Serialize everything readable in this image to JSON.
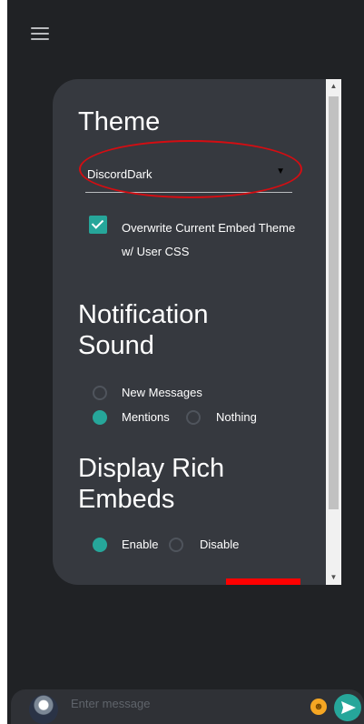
{
  "settings": {
    "theme": {
      "heading": "Theme",
      "selected": "DiscordDark",
      "overwrite_label": "Overwrite Current Embed Theme w/ User CSS",
      "overwrite_checked": true
    },
    "notification": {
      "heading": "Notification Sound",
      "options": [
        "New Messages",
        "Mentions",
        "Nothing"
      ],
      "selected": "Mentions"
    },
    "rich_embeds": {
      "heading": "Display Rich Embeds",
      "options": [
        "Enable",
        "Disable"
      ],
      "selected": "Enable"
    }
  },
  "composer": {
    "placeholder": "Enter message"
  },
  "colors": {
    "background": "#202225",
    "panel": "#36393f",
    "accent": "#26a69a",
    "annotation": "#d40d12"
  },
  "icons": {
    "menu": "hamburger-icon",
    "select_caret": "triangle-down-icon",
    "emoji": "smiley-icon",
    "send": "send-arrow-icon"
  }
}
